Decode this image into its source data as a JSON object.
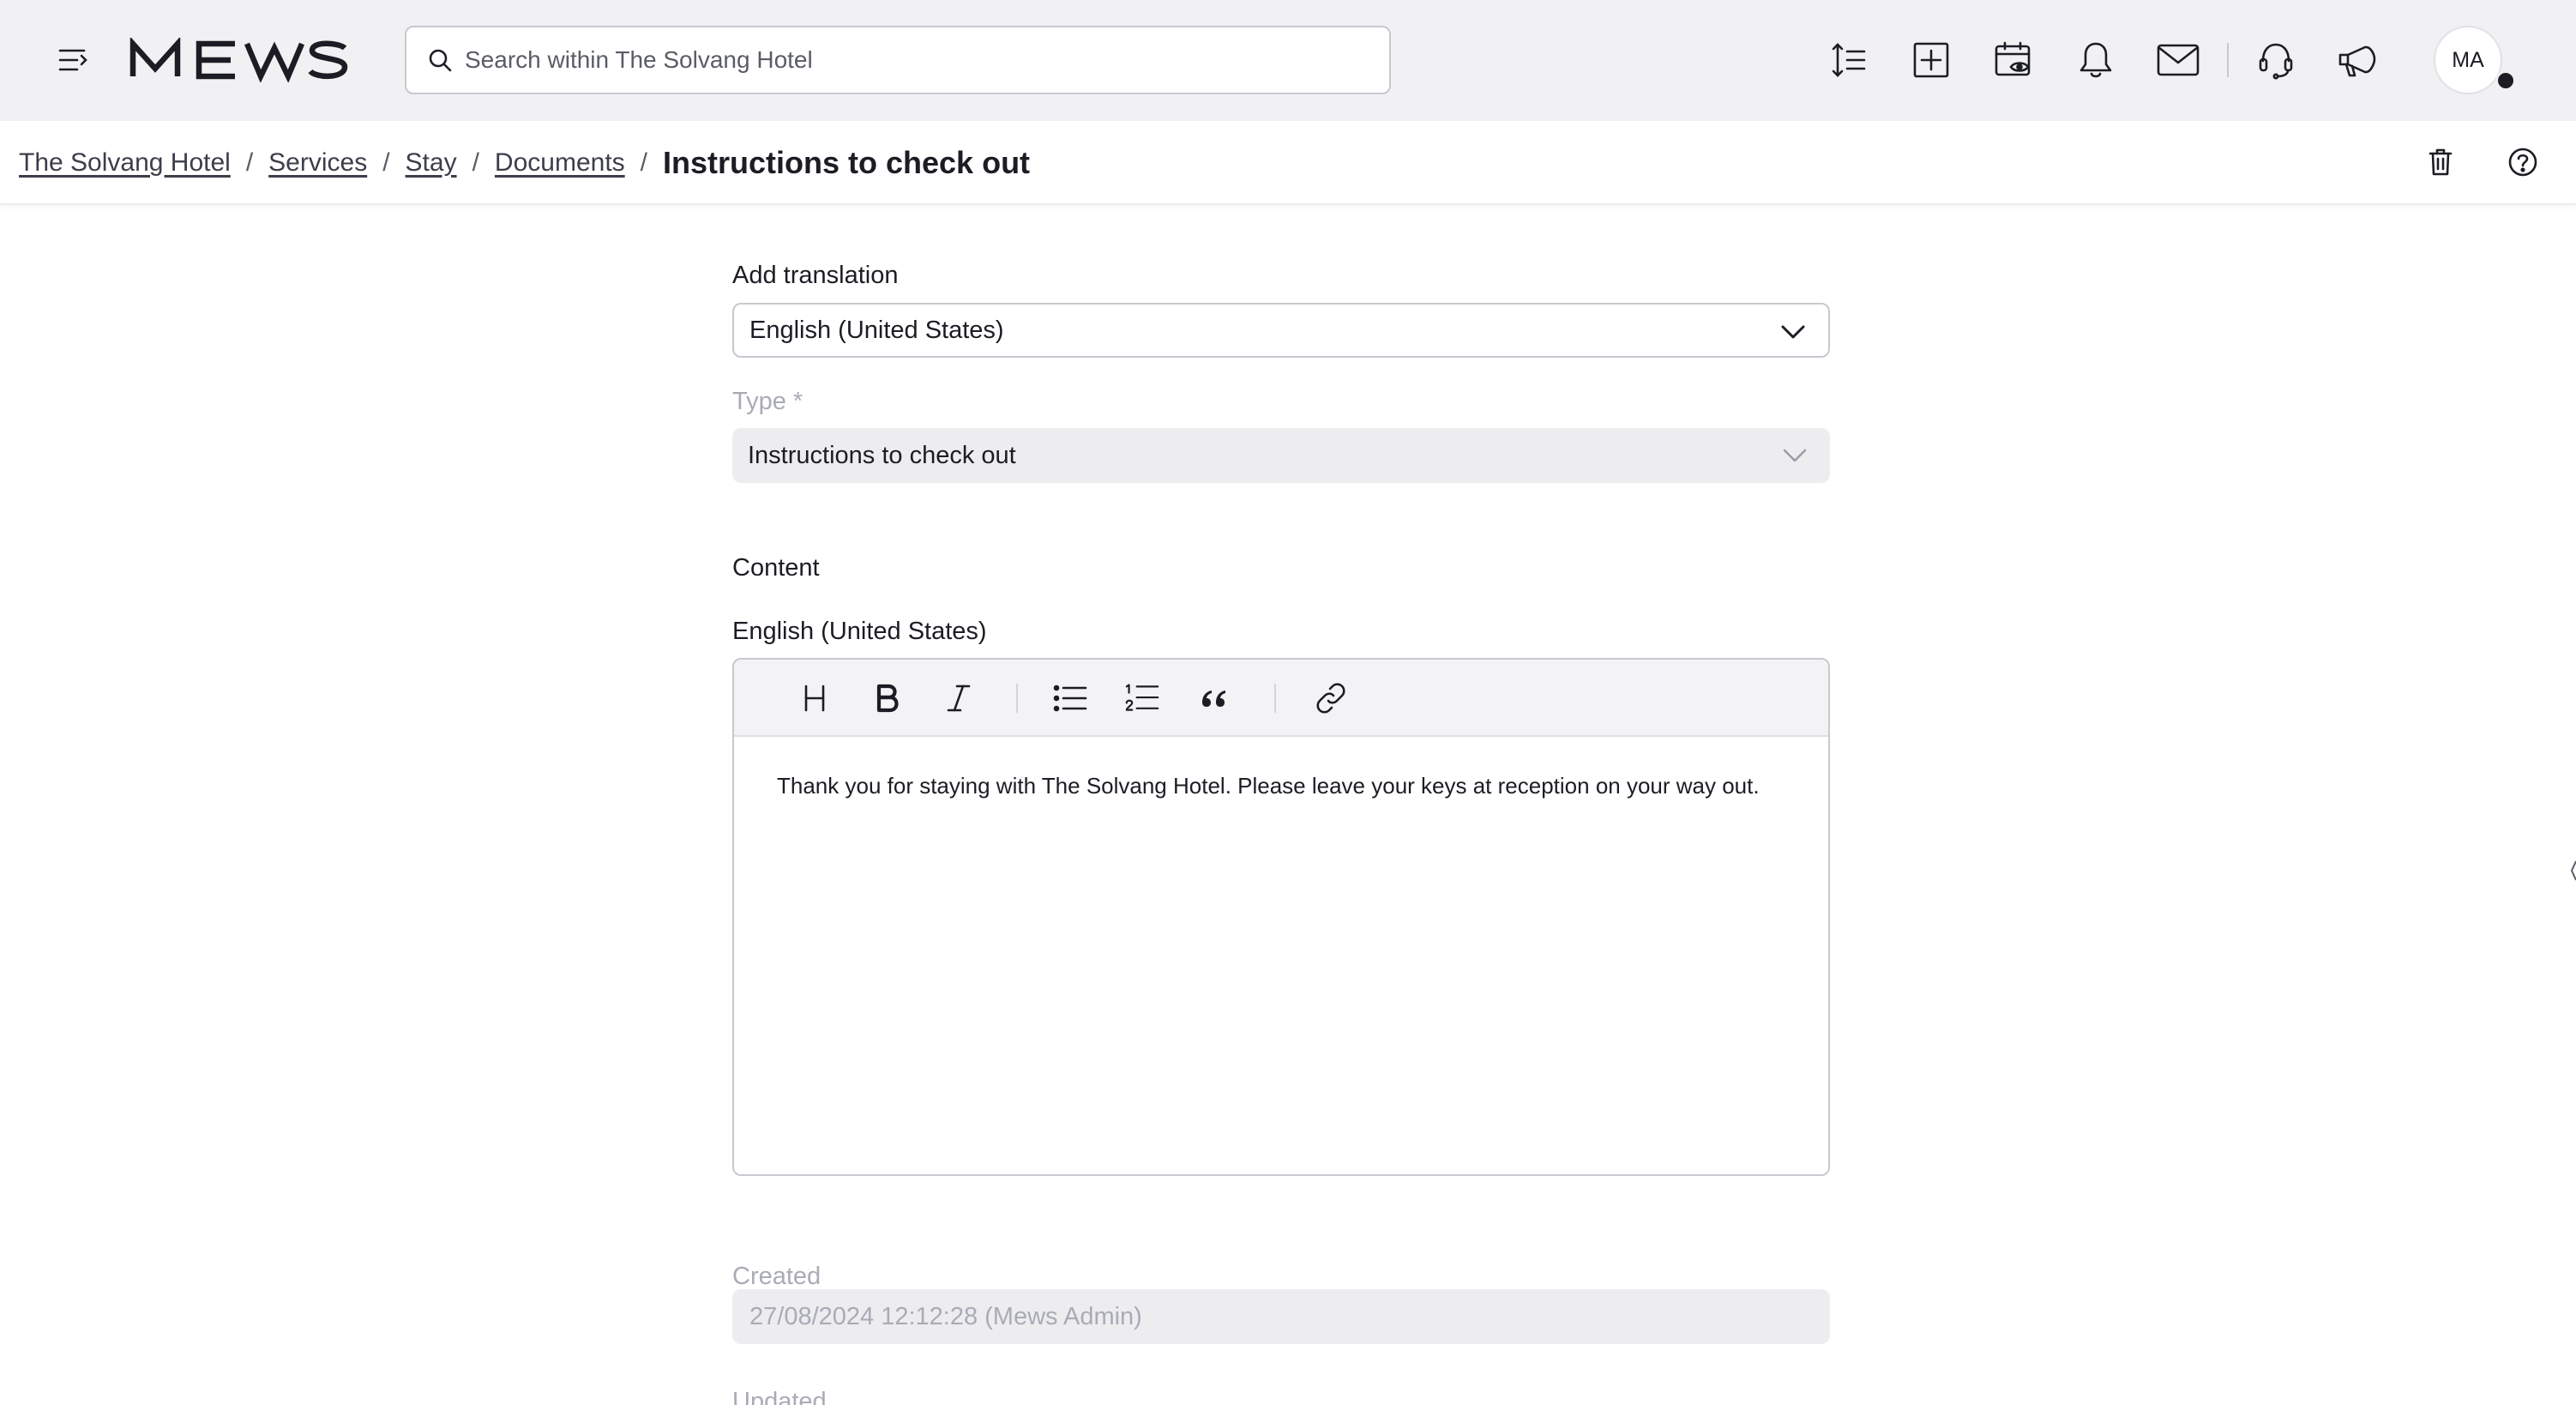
{
  "app": {
    "brand": "MEWS",
    "accent_color": "#1c1d24",
    "background_color": "#f1f1f3"
  },
  "header": {
    "menu_icon": "menu-collapse-icon",
    "search": {
      "placeholder": "Search within The Solvang Hotel",
      "value": ""
    },
    "actions": [
      {
        "name": "timeline-icon"
      },
      {
        "name": "add-square-icon"
      },
      {
        "name": "calendar-view-icon"
      },
      {
        "name": "bell-icon"
      },
      {
        "name": "mail-icon"
      },
      {
        "name": "headset-icon"
      },
      {
        "name": "megaphone-icon"
      }
    ],
    "avatar_initials": "MA"
  },
  "breadcrumb": {
    "items": [
      "The Solvang Hotel",
      "Services",
      "Stay",
      "Documents"
    ],
    "separator": "/",
    "current": "Instructions to check out",
    "actions": [
      {
        "name": "trash-icon"
      },
      {
        "name": "help-icon"
      }
    ]
  },
  "form": {
    "translation": {
      "label": "Add translation",
      "value": "English (United States)"
    },
    "type": {
      "label": "Type *",
      "value": "Instructions to check out"
    },
    "content": {
      "section_title": "Content",
      "editor_label": "English (United States)",
      "toolbar": [
        "heading-icon",
        "bold-icon",
        "italic-icon",
        "bullet-list-icon",
        "numbered-list-icon",
        "quote-icon",
        "link-icon"
      ],
      "text": "Thank you for staying with The Solvang Hotel. Please leave your keys at reception on your way out."
    },
    "created": {
      "label": "Created",
      "value": "27/08/2024 12:12:28 (Mews Admin)"
    },
    "updated": {
      "label": "Updated"
    }
  }
}
